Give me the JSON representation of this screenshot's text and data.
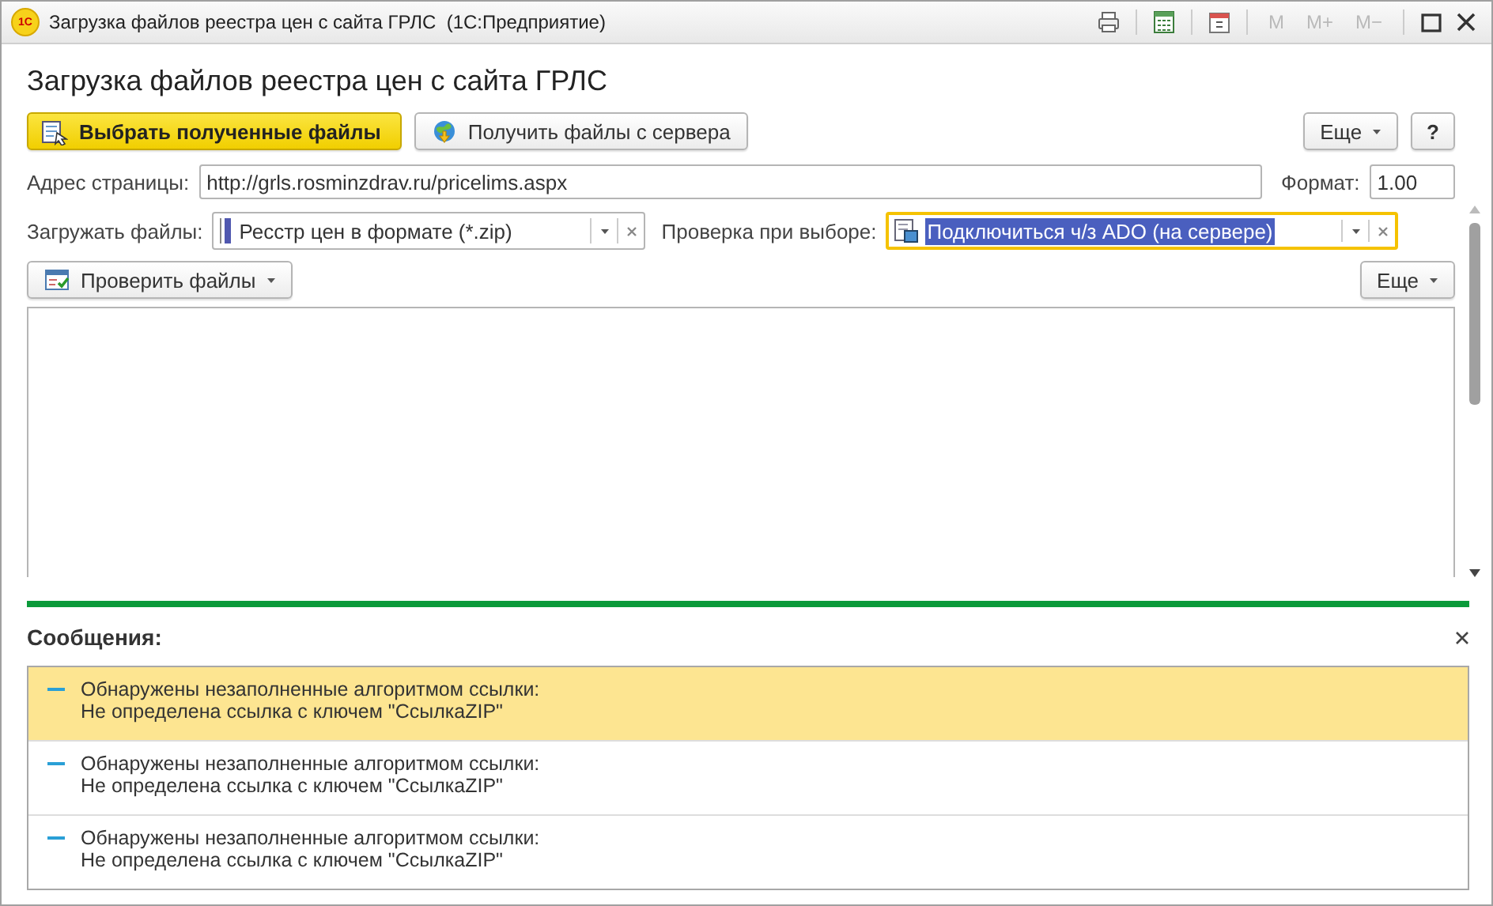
{
  "window": {
    "title": "Загрузка файлов реестра цен с сайта ГРЛС  (1С:Предприятие)",
    "app_icon": "1C",
    "memory_buttons": [
      "M",
      "M+",
      "M−"
    ]
  },
  "form": {
    "title": "Загрузка файлов реестра цен с сайта ГРЛС",
    "toolbar": {
      "primary": "Выбрать полученные файлы",
      "secondary": "Получить файлы с сервера",
      "more": "Еще",
      "help": "?"
    },
    "address": {
      "label": "Адрес страницы:",
      "value": "http://grls.rosminzdrav.ru/pricelims.aspx"
    },
    "format": {
      "label": "Формат:",
      "value": "1.00"
    },
    "load": {
      "label": "Загружать файлы:",
      "value": "Ресстр цен в формате (*.zip)",
      "focused": false
    },
    "check": {
      "label": "Проверка при выборе:",
      "value": "Подключиться ч/з ADO (на сервере)",
      "focused": true
    },
    "list_toolbar": {
      "check_button": "Проверить файлы",
      "more": "Еще"
    }
  },
  "messages": {
    "title": "Сообщения:",
    "items": [
      {
        "text": "Обнаружены незаполненные алгоритмом ссылки:",
        "detail": "Не определена ссылка с ключем \"СсылкаZIP\"",
        "selected": true
      },
      {
        "text": "Обнаружены незаполненные алгоритмом ссылки:",
        "detail": "Не определена ссылка с ключем \"СсылкаZIP\"",
        "selected": false
      },
      {
        "text": "Обнаружены незаполненные алгоритмом ссылки:",
        "detail": "Не определена ссылка с ключем \"СсылкаZIP\"",
        "selected": false
      }
    ]
  }
}
